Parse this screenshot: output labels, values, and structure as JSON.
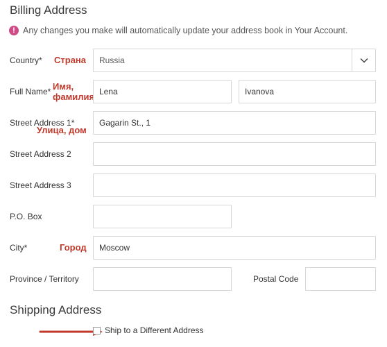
{
  "billing": {
    "title": "Billing Address",
    "notice": "Any changes you make will automatically update your address book in Your Account.",
    "notice_icon": "!",
    "fields": {
      "country": {
        "label": "Country*",
        "annotation": "Страна",
        "value": "Russia"
      },
      "full_name": {
        "label": "Full Name*",
        "annotation_line1": "Имя,",
        "annotation_line2": "фамилия",
        "first_value": "Lena",
        "last_value": "Ivanova"
      },
      "street1": {
        "label": "Street Address 1*",
        "annotation": "Улица, дом",
        "value": "Gagarin St., 1"
      },
      "street2": {
        "label": "Street Address 2",
        "value": ""
      },
      "street3": {
        "label": "Street Address 3",
        "value": ""
      },
      "po_box": {
        "label": "P.O. Box",
        "value": ""
      },
      "city": {
        "label": "City*",
        "annotation": "Город",
        "value": "Moscow"
      },
      "province": {
        "label": "Province / Territory",
        "value": ""
      },
      "postal": {
        "label": "Postal Code",
        "value": ""
      }
    }
  },
  "shipping": {
    "title": "Shipping Address",
    "checkbox_label": "Ship to a Different Address",
    "checked": false
  },
  "colors": {
    "annotation": "#c0392b",
    "notice_icon": "#d04a86",
    "field_border": "#d6d6d6"
  },
  "icons": {
    "notice": "exclamation-circle-icon",
    "dropdown": "chevron-down-icon",
    "pointer": "red-arrow-annotation"
  }
}
